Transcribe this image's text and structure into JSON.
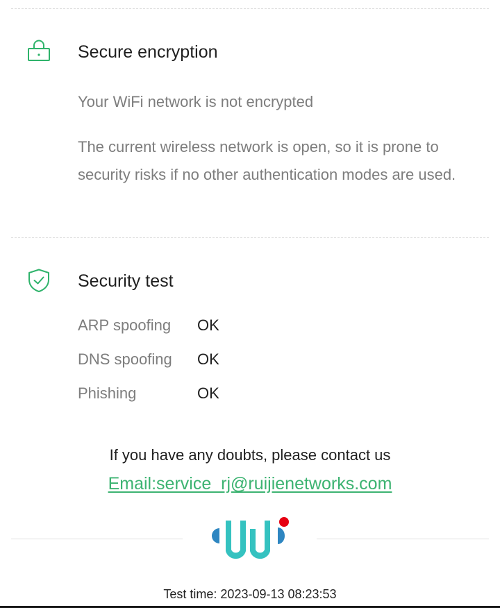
{
  "encryption": {
    "title": "Secure encryption",
    "status": "Your WiFi network is not encrypted",
    "description": "The current wireless network is open, so it is prone to security risks if no other authentication modes are used.",
    "icon": "lock-icon"
  },
  "security_test": {
    "title": "Security test",
    "icon": "shield-check-icon",
    "rows": [
      {
        "label": "ARP spoofing",
        "value": "OK"
      },
      {
        "label": "DNS spoofing",
        "value": "OK"
      },
      {
        "label": "Phishing",
        "value": "OK"
      }
    ]
  },
  "contact": {
    "text": "If you have any doubts, please contact us",
    "email_text": "Email:service_rj@ruijienetworks.com"
  },
  "footer": {
    "logo": "wi-logo",
    "test_time": "Test time: 2023-09-13 08:23:53"
  },
  "colors": {
    "accent_green": "#3cb371",
    "icon_green": "#2fb36b",
    "logo_teal": "#35c2c0",
    "logo_blue": "#2e86c1",
    "logo_red": "#e60012"
  }
}
